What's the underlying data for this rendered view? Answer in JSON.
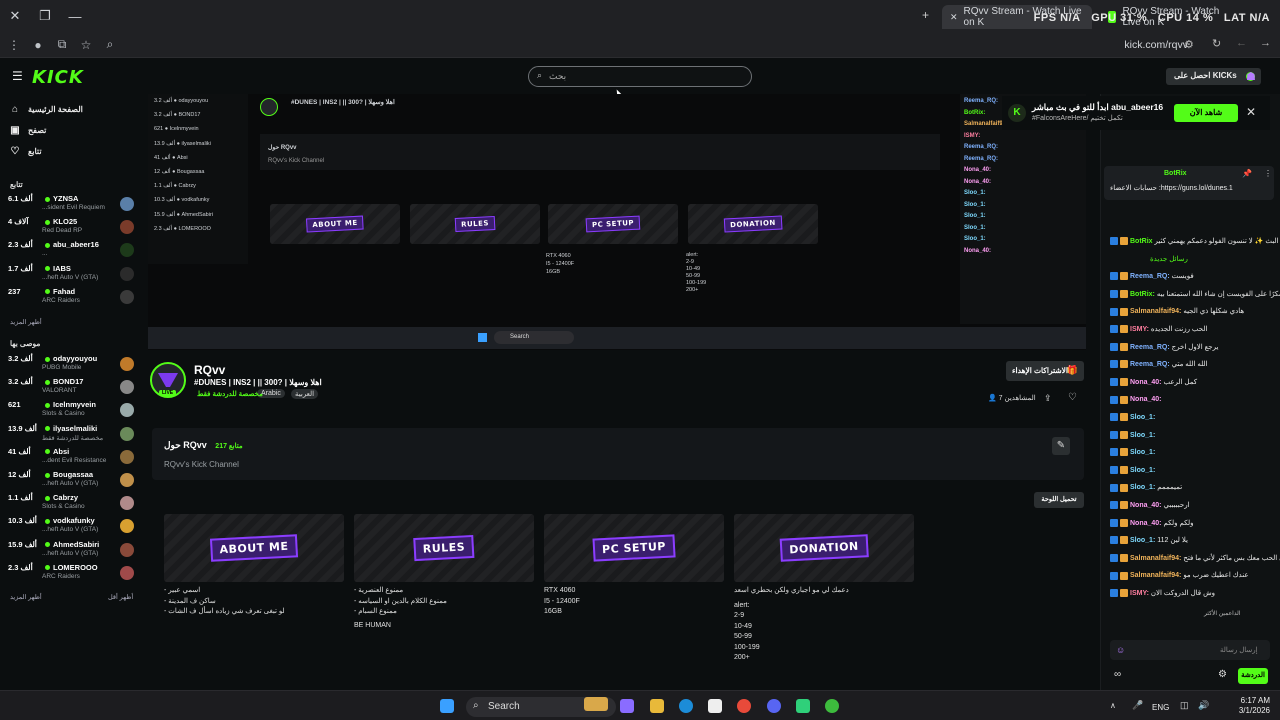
{
  "browser": {
    "tabs": [
      {
        "title": "RQvv Stream - Watch Live on K"
      },
      {
        "title": "RQvv Stream - Watch Live on K"
      }
    ],
    "overlay": {
      "fps": "FPS N/A",
      "gpu": "GPU 31 %",
      "cpu": "CPU 14 %",
      "lat": "LAT N/A"
    },
    "url": "kick.com/rqvv"
  },
  "header": {
    "logo": "KICK",
    "search_placeholder": "بحث",
    "get_kicks": "احصل على KICKs"
  },
  "sidebar": {
    "nav": [
      {
        "label": "الصفحة الرئيسية",
        "icon": "home-icon",
        "glyph": "⌂"
      },
      {
        "label": "تصفح",
        "icon": "browse-icon",
        "glyph": "▣"
      },
      {
        "label": "تتابع",
        "icon": "heart-icon",
        "glyph": "♡"
      }
    ],
    "following_title": "تتابع",
    "following": [
      {
        "viewers": "6.1 ألف",
        "name": "YZNSA",
        "game": "...sident Evil Requiem",
        "color": "#5a7fa8"
      },
      {
        "viewers": "4 آلاف",
        "name": "KLO25",
        "game": "Red Dead RP",
        "color": "#7a3b2a"
      },
      {
        "viewers": "2.3 ألف",
        "name": "abu_abeer16",
        "game": "...",
        "color": "#1d3a1a"
      },
      {
        "viewers": "1.7 ألف",
        "name": "IABS",
        "game": "...heft Auto V (GTA)",
        "color": "#2b2b2b"
      },
      {
        "viewers": "237",
        "name": "Fahad",
        "game": "ARC Raiders",
        "color": "#3a3a3a"
      }
    ],
    "show_more_1": "أظهر المزيد",
    "recommended_title": "موصى بها",
    "recommended": [
      {
        "viewers": "3.2 ألف",
        "name": "odayyouyou",
        "game": "PUBG Mobile",
        "color": "#c07a2a"
      },
      {
        "viewers": "3.2 ألف",
        "name": "BOND17",
        "game": "VALORANT",
        "color": "#888"
      },
      {
        "viewers": "621",
        "name": "Icelnmyvein",
        "game": "Slots & Casino",
        "color": "#9aa"
      },
      {
        "viewers": "13.9 ألف",
        "name": "ilyaselmaliki",
        "game": "مخصصة للدردشة فقط",
        "color": "#6a8a5a"
      },
      {
        "viewers": "41 ألف",
        "name": "Absi",
        "game": "...dent Evil Resistance",
        "color": "#8a6a3a"
      },
      {
        "viewers": "12 ألف",
        "name": "Bougassaa",
        "game": "...heft Auto V (GTA)",
        "color": "#c0904a"
      },
      {
        "viewers": "1.1 ألف",
        "name": "Cabrzy",
        "game": "Slots & Casino",
        "color": "#b08a8a"
      },
      {
        "viewers": "10.3 ألف",
        "name": "vodkafunky",
        "game": "...heft Auto V (GTA)",
        "color": "#d8a030"
      },
      {
        "viewers": "15.9 ألف",
        "name": "AhmedSabiri",
        "game": "...heft Auto V (GTA)",
        "color": "#8a4a3a"
      },
      {
        "viewers": "2.3 ألف",
        "name": "LOMEROOO",
        "game": "ARC Raiders",
        "color": "#a04a4a"
      }
    ],
    "show_more_2": "أظهر المزيد",
    "show_less": "أظهر أقل"
  },
  "channel": {
    "name": "RQvv",
    "live": "LIVE",
    "stream_title": "#DUNES | INS2 | || 300? | اهلا وسهلا",
    "category": "مخصصة للدردشة فقط",
    "tags": [
      "Arabic",
      "العربية"
    ],
    "gift_subs": "الاشتراكات الإهداء",
    "viewers_label": "المشاهدين 7",
    "about_title": "حول RQvv",
    "followers": "217 متابع",
    "about_sub": "RQvv's Kick Channel",
    "edit_panels": "تحميل اللوحة",
    "panels": [
      {
        "banner": "ABOUT ME",
        "lines": [
          "- اسمي عبير",
          "- ساكن ف المدينة",
          "- لو تبغى تعرف شي زياده اسأل ف الشات"
        ]
      },
      {
        "banner": "RULES",
        "lines": [
          "- ممنوع العنصرية",
          "- ممنوع الكلام بالدين او السياسه",
          "- ممنوع السبام",
          "BE HUMAN"
        ]
      },
      {
        "banner": "PC SETUP",
        "lines": [
          "RTX 4060",
          "I5 - 12400F",
          "16GB"
        ]
      },
      {
        "banner": "DONATION",
        "lines": [
          "دعمك لي مو اجباري ولكن بحطري اسعد",
          "alert:",
          "2-9",
          "10-49",
          "50-99",
          "100-199",
          "200+"
        ]
      }
    ]
  },
  "notification": {
    "title": "ابدأ للتو في بث مباشر abu_abeer16",
    "sub": "#FalconsAreHere/ تكمل تختيم",
    "watch_now": "شاهد الآن"
  },
  "chat": {
    "pinned_user": "BotRix",
    "pinned_text": "حسابات الاعضاء :https://guns.lol/dunes.1",
    "messages": [
      {
        "user": "BotRix",
        "text": "حياكم الله في البث ✨ لا تنسون الفولو دعمكم يهمني كثير",
        "color": "#53fc18"
      },
      {
        "user": "",
        "text": "رسائل جديدة",
        "color": "#53fc18"
      },
      {
        "user": "Reema_RQ:",
        "text": "فويست",
        "color": "#7fb2ff"
      },
      {
        "user": "BotRix:",
        "text": "شكرًا على الفويست إن شاء الله استمتعنا بيه",
        "color": "#53fc18"
      },
      {
        "user": "Salmanalfaif94:",
        "text": "هادي شكلها ذي الجيه",
        "color": "#f0b35a"
      },
      {
        "user": "ISMY:",
        "text": "الحب رزنت الجديده",
        "color": "#ff7fa0"
      },
      {
        "user": "Reema_RQ:",
        "text": "يرجع الاول اخرج",
        "color": "#7fb2ff"
      },
      {
        "user": "Reema_RQ:",
        "text": "الله الله متي",
        "color": "#7fb2ff"
      },
      {
        "user": "Nona_40:",
        "text": "كمل الرعب",
        "color": "#ff9ff3"
      },
      {
        "user": "Nona_40:",
        "text": "",
        "color": "#ff9ff3"
      },
      {
        "user": "Sloo_1:",
        "text": "",
        "color": "#7fdbff"
      },
      {
        "user": "Sloo_1:",
        "text": "",
        "color": "#7fdbff"
      },
      {
        "user": "Sloo_1:",
        "text": "",
        "color": "#7fdbff"
      },
      {
        "user": "Sloo_1:",
        "text": "",
        "color": "#7fdbff"
      },
      {
        "user": "Sloo_1:",
        "text": "تميمممم",
        "color": "#7fdbff"
      },
      {
        "user": "Nona_40:",
        "text": "ارحبببببي",
        "color": "#ff9ff3"
      },
      {
        "user": "Nona_40:",
        "text": "ولكم ولكم",
        "color": "#ff9ff3"
      },
      {
        "user": "Sloo_1:",
        "text": "يلا لين 112",
        "color": "#7fdbff"
      },
      {
        "user": "Salmanalfaif94:",
        "text": "وش ابي الحب معك بس ماكثر لأني ما فتح",
        "color": "#f0b35a"
      },
      {
        "user": "Salmanalfaif94:",
        "text": "عندك اعطيك ضرب مو",
        "color": "#f0b35a"
      },
      {
        "user": "ISMY:",
        "text": "وش قال الدروكت الان",
        "color": "#ff7fa0"
      }
    ],
    "input_placeholder": "إرسال رسالة",
    "send": "الدردشة",
    "top_gifters": "الداعمين الأكثر"
  },
  "taskbar": {
    "search": "Search",
    "lang": "ENG",
    "time": "6:17 AM",
    "date": "3/1/2026"
  }
}
